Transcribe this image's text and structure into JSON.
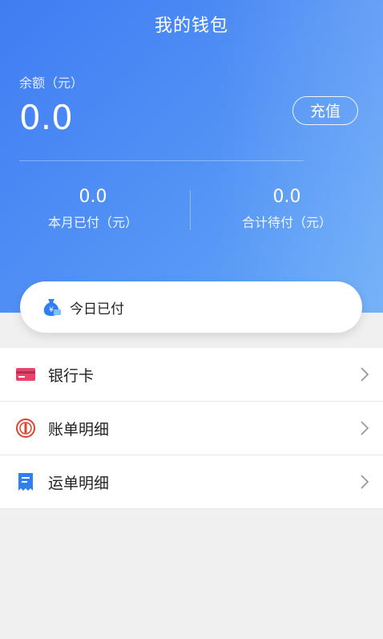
{
  "header": {
    "title": "我的钱包",
    "balance_label": "余额（元）",
    "balance_value": "0.0",
    "recharge_label": "充值"
  },
  "stats": {
    "month_paid": {
      "value": "0.0",
      "label": "本月已付（元）"
    },
    "total_pending": {
      "value": "0.0",
      "label": "合计待付（元）"
    }
  },
  "today_card": {
    "label": "今日已付",
    "icon": "money-bag-icon"
  },
  "menu": {
    "items": [
      {
        "label": "银行卡",
        "icon": "bank-card-icon"
      },
      {
        "label": "账单明细",
        "icon": "bill-icon"
      },
      {
        "label": "运单明细",
        "icon": "waybill-icon"
      }
    ]
  },
  "colors": {
    "header_start": "#3f7df2",
    "header_end": "#63a8f7",
    "bank_card": "#e8436a",
    "bill": "#d6462e",
    "waybill": "#2f7ff0"
  }
}
